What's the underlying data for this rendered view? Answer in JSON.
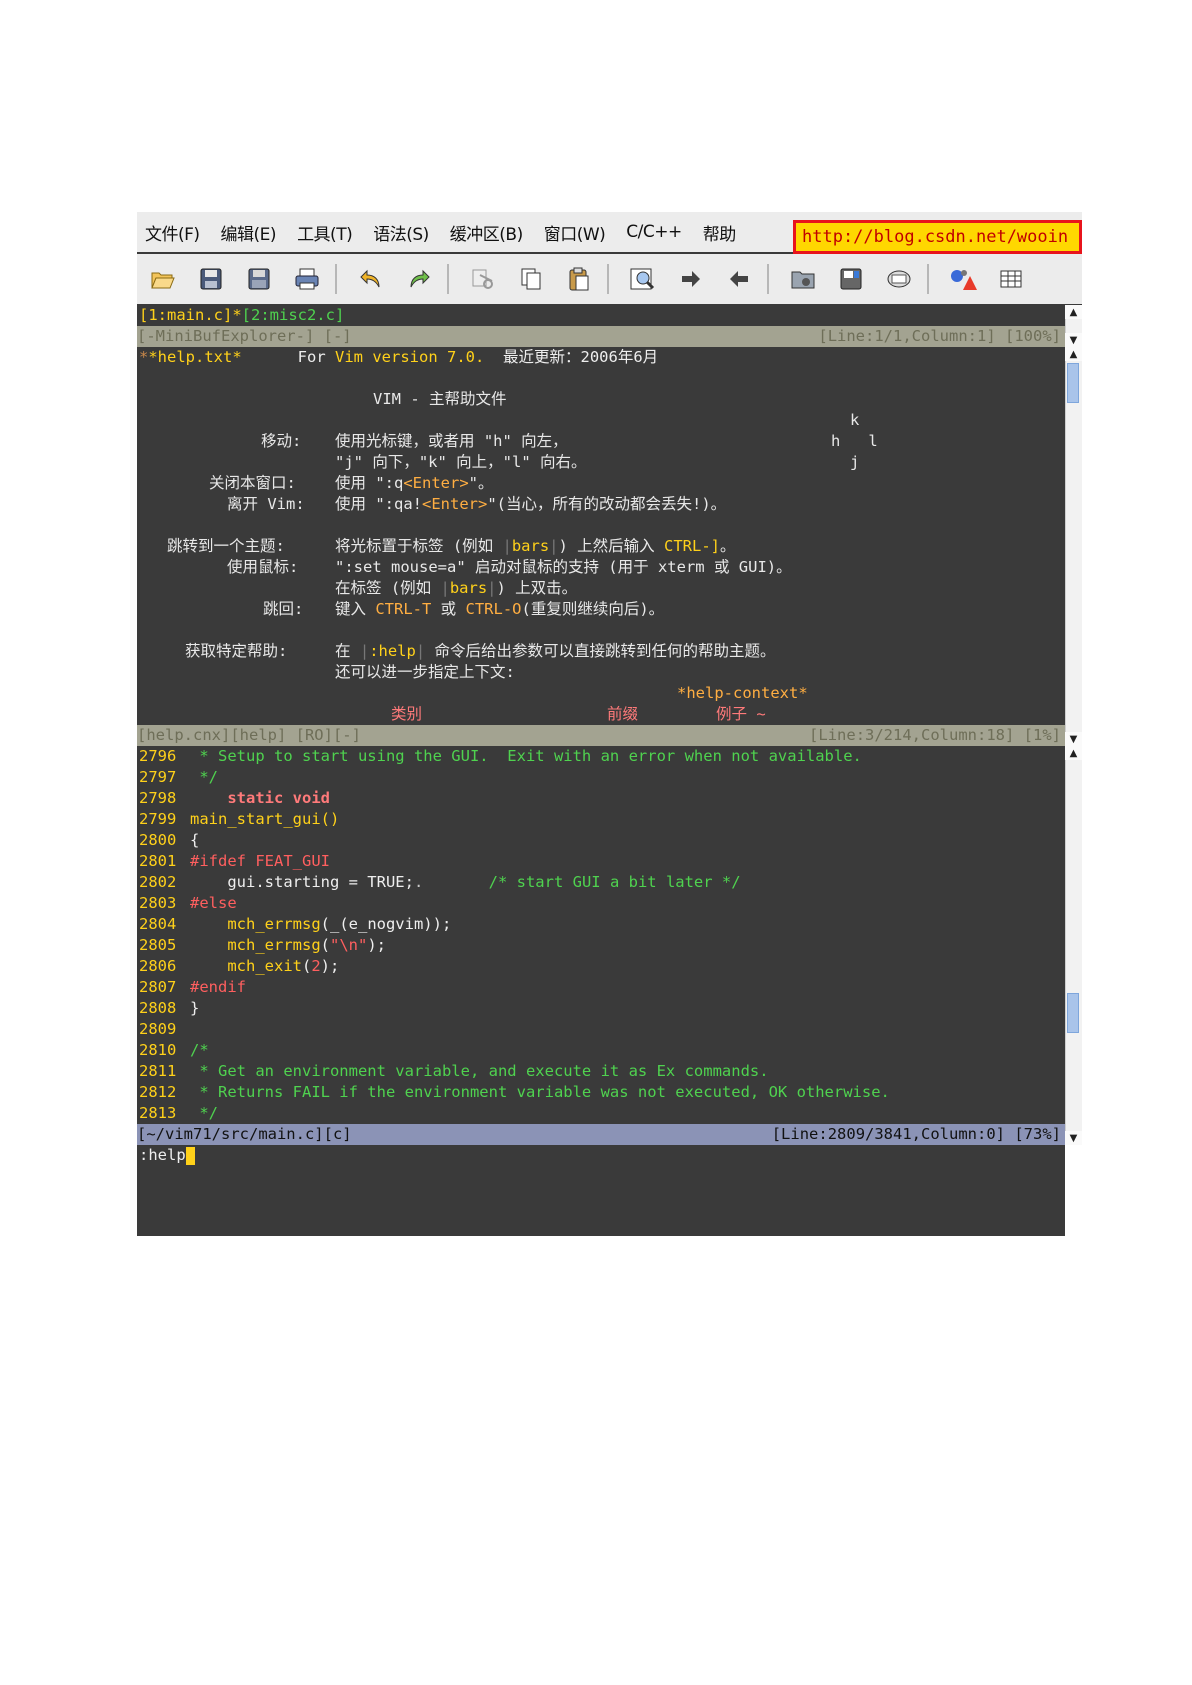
{
  "menu": {
    "items": [
      "文件(F)",
      "编辑(E)",
      "工具(T)",
      "语法(S)",
      "缓冲区(B)",
      "窗口(W)",
      "C/C++",
      "帮助"
    ],
    "url": "http://blog.csdn.net/wooin"
  },
  "toolbar": {
    "icons": [
      "open-icon",
      "save-icon",
      "save-all-icon",
      "print-icon",
      "undo-icon",
      "redo-icon",
      "cut-icon",
      "copy-icon",
      "paste-icon",
      "find-replace-icon",
      "find-next-icon",
      "find-prev-icon",
      "load-session-icon",
      "save-session-icon",
      "run-script-icon",
      "make-icon",
      "tags-icon"
    ]
  },
  "minibuf": {
    "tabs_active": "[1:main.c]*",
    "tabs_inactive": "[2:misc2.c]",
    "status_left": "[-MiniBufExplorer-] [-]",
    "status_right": "[Line:1/1,Column:1] [100%]"
  },
  "help": {
    "tag": "*help.txt*",
    "for": "For",
    "version": "Vim version 7.0.",
    "updated": "最近更新：2006年6月",
    "title": "VIM - 主帮助文件",
    "k": "k",
    "hl": "h   l",
    "j": "j",
    "move_label": "移动:",
    "move_text1": "使用光标键，或者用 \"h\" 向左，",
    "move_text2": "\"j\" 向下，\"k\" 向上，\"l\" 向右。",
    "close_label": "关闭本窗口:",
    "close_text_a": "使用 \":q",
    "close_text_b": "<Enter>",
    "close_text_c": "\"。",
    "quit_label": "离开 Vim:",
    "quit_text_a": "使用 \":qa!",
    "quit_text_b": "<Enter>",
    "quit_text_c": "\"(当心，所有的改动都会丢失!)。",
    "jump_label": "跳转到一个主题:",
    "jump_text_a": "将光标置于标签 (例如 ",
    "jump_bars": "bars",
    "jump_text_b": ") 上然后输入 ",
    "jump_key": "CTRL-]",
    "jump_text_c": "。",
    "mouse_label": "使用鼠标:",
    "mouse_text": "\":set mouse=a\" 启动对鼠标的支持 (用于 xterm 或 GUI)。",
    "mouse_text2_a": "在标签 (例如 ",
    "mouse_bars": "bars",
    "mouse_text2_b": ") 上双击。",
    "back_label": "跳回:",
    "back_text_a": "键入 ",
    "back_key1": "CTRL-T",
    "back_text_b": " 或 ",
    "back_key2": "CTRL-O",
    "back_text_c": "(重复则继续向后)。",
    "get_label": "获取特定帮助:",
    "get_text_a": "在 ",
    "get_help": ":help",
    "get_text_b": " 命令后给出参数可以直接跳转到任何的帮助主题。",
    "get_text2": "还可以进一步指定上下文:",
    "context": "*help-context*",
    "col_category": "类别",
    "col_prefix": "前缀",
    "col_example": "例子 ~",
    "status_left": "[help.cnx][help] [RO][-]",
    "status_right": "[Line:3/214,Column:18] [1%]"
  },
  "code": {
    "lines": [
      {
        "n": "2796",
        "text": " * Setup to start using the GUI.  Exit with an error when not available."
      },
      {
        "n": "2797",
        "text": " */"
      },
      {
        "n": "2798",
        "text": "    static void"
      },
      {
        "n": "2799",
        "text": "main_start_gui()"
      },
      {
        "n": "2800",
        "text": "{"
      },
      {
        "n": "2801",
        "text": "#ifdef FEAT_GUI"
      },
      {
        "n": "2802",
        "a": "    gui.starting = TRUE;",
        "dot": ".",
        "comment": "       /* start GUI a bit later */"
      },
      {
        "n": "2803",
        "text": "#else"
      },
      {
        "n": "2804",
        "fn": "    mch_errmsg",
        "rest": "(_(e_nogvim));"
      },
      {
        "n": "2805",
        "fn": "    mch_errmsg",
        "p1": "(",
        "str": "\"\\n\"",
        "p2": ");"
      },
      {
        "n": "2806",
        "fn": "    mch_exit",
        "p1": "(",
        "num": "2",
        "p2": ");"
      },
      {
        "n": "2807",
        "text": "#endif"
      },
      {
        "n": "2808",
        "text": "}"
      },
      {
        "n": "2809",
        "text": ""
      },
      {
        "n": "2810",
        "text": "/*"
      },
      {
        "n": "2811",
        "text": " * Get an environment variable, and execute it as Ex commands."
      },
      {
        "n": "2812",
        "text": " * Returns FAIL if the environment variable was not executed, OK otherwise."
      },
      {
        "n": "2813",
        "text": " */"
      }
    ],
    "status_left": "[~/vim71/src/main.c][c]",
    "status_right": "[Line:2809/3841,Column:0] [73%]"
  },
  "cmdline": ":help"
}
